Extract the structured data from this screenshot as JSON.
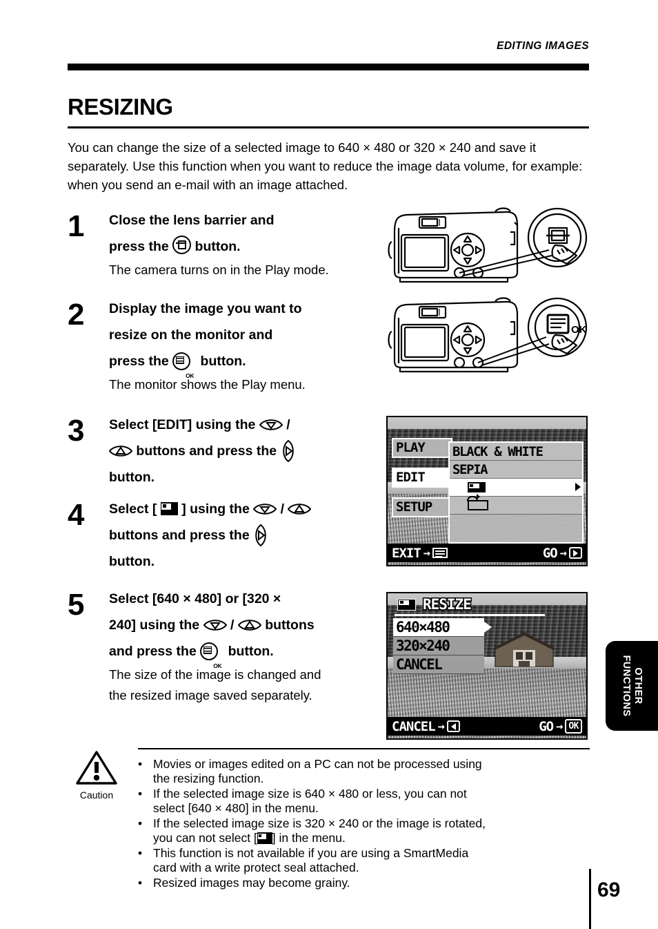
{
  "header": {
    "running_head": "EDITING IMAGES"
  },
  "page_title": "RESIZING",
  "intro": "You can change the size of a selected image to 640 × 480 or 320 × 240 and save it separately. Use this function when you want to reduce the image data volume, for example: when you send an e-mail with an image attached.",
  "steps": [
    {
      "number": "1",
      "head_a": "Close the lens barrier and",
      "head_b_pre": "press the",
      "head_b_post": "button.",
      "sub": "The camera turns on in the Play mode."
    },
    {
      "number": "2",
      "head_a": "Display the image you want to",
      "head_b": "resize on the monitor and",
      "head_c_pre": "press the",
      "head_c_post": "button.",
      "sub": "The monitor shows the Play menu."
    },
    {
      "number": "3",
      "head_a_pre": "Select [EDIT] using the",
      "head_a_slash": "/",
      "head_b_pre": "buttons and press the",
      "head_c": "button."
    },
    {
      "number": "4",
      "head_a_pre": "Select [",
      "head_a_mid": "] using the",
      "head_a_slash": "/",
      "head_b_pre": "buttons and press the",
      "head_c": "button."
    },
    {
      "number": "5",
      "head_a": "Select [640 × 480] or [320 ×",
      "head_b_pre": "240] using the",
      "head_b_slash": "/",
      "head_b_post": "buttons",
      "head_c_pre": "and press the",
      "head_c_post": "button.",
      "sub_a": "The size of the image is changed and",
      "sub_b": "the resized image saved separately."
    }
  ],
  "lcd_edit_menu": {
    "left_menu": [
      {
        "label": "PLAY",
        "active": false
      },
      {
        "label": "EDIT",
        "active": true
      },
      {
        "label": "SETUP",
        "active": false
      }
    ],
    "submenu": [
      {
        "label": "BLACK & WHITE",
        "glyph": "",
        "selected": false
      },
      {
        "label": "SEPIA",
        "glyph": "",
        "selected": false
      },
      {
        "label": "",
        "glyph": "resize-icon",
        "selected": true
      },
      {
        "label": "",
        "glyph": "rotate-icon",
        "selected": false
      }
    ],
    "bottom_bar": {
      "left_label": "EXIT",
      "left_arrow": "→",
      "left_glyph": "menu-icon",
      "right_label": "GO",
      "right_arrow": "→",
      "right_glyph": "right-button-icon"
    }
  },
  "lcd_resize_menu": {
    "title": "RESIZE",
    "title_glyph": "resize-icon",
    "options": [
      {
        "label": "640×480",
        "selected": true
      },
      {
        "label": "320×240",
        "selected": false
      },
      {
        "label": "CANCEL",
        "selected": false
      }
    ],
    "bottom_bar": {
      "left_label": "CANCEL",
      "left_arrow": "→",
      "left_glyph": "left-button-icon",
      "right_label": "GO",
      "right_arrow": "→",
      "right_glyph": "OK"
    }
  },
  "caution": {
    "label": "Caution",
    "bullet": "•",
    "items": [
      {
        "text_a": "Movies or images edited on a PC can not be processed using",
        "text_b": "the resizing function."
      },
      {
        "text_a": "If the selected image size is 640 × 480 or less, you can not",
        "text_b": "select [640 × 480] in the menu."
      },
      {
        "text_a": "If the selected image size is 320 × 240 or the image is rotated,",
        "text_b_pre": "you can not select [",
        "text_b_post": "] in the menu."
      },
      {
        "text_a": "This function is not available if you are using a SmartMedia",
        "text_b": "card with a write protect seal attached."
      },
      {
        "text_a": "Resized images may become grainy.",
        "text_b": ""
      }
    ]
  },
  "side_tab": {
    "line1": "OTHER",
    "line2": "FUNCTIONS"
  },
  "page_number": "69",
  "colors": {
    "ink": "#000000",
    "paper": "#ffffff"
  }
}
